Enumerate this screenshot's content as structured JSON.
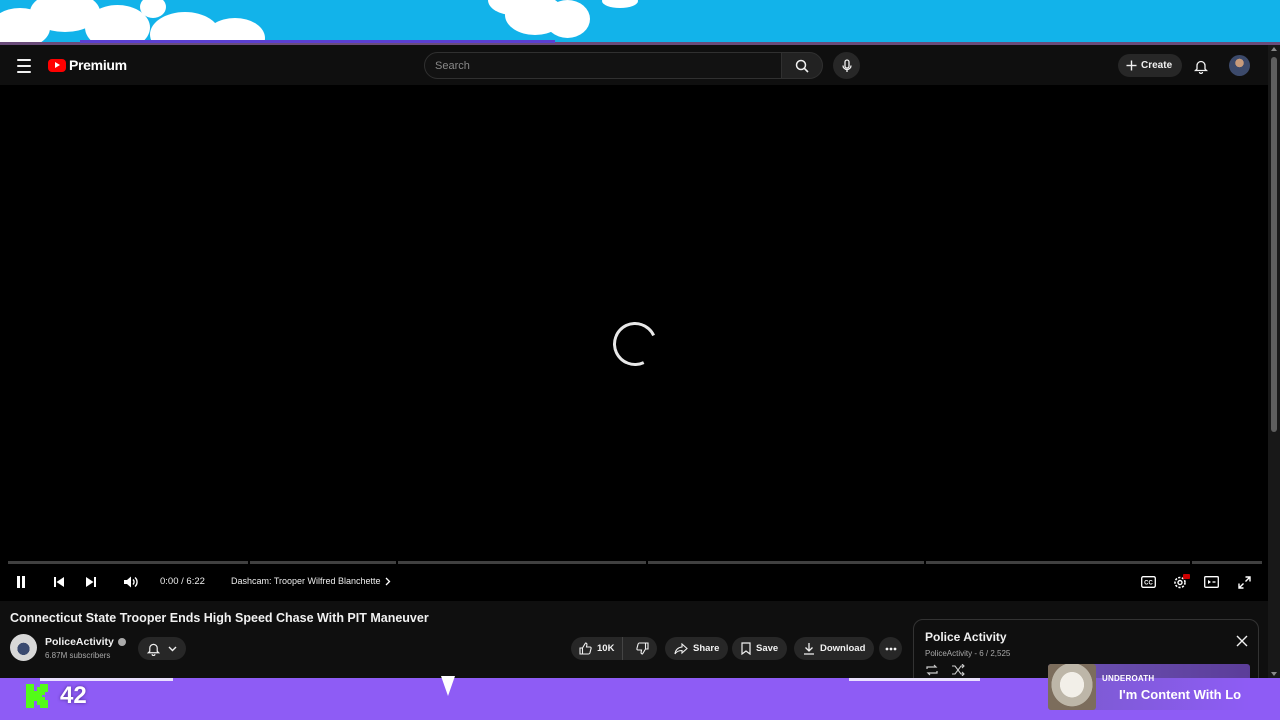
{
  "header": {
    "logo_text": "Premium",
    "search_placeholder": "Search",
    "create_label": "Create"
  },
  "player": {
    "state": "loading",
    "time": "0:00 / 6:22",
    "chapter_title": "Dashcam: Trooper Wilfred Blanchette"
  },
  "video": {
    "title": "Connecticut State Trooper Ends High Speed Chase With PIT Maneuver",
    "channel_name": "PoliceActivity",
    "subscribers": "6.87M subscribers",
    "likes": "10K",
    "share_label": "Share",
    "save_label": "Save",
    "download_label": "Download"
  },
  "playlist": {
    "title": "Police Activity",
    "subtitle": "PoliceActivity - 6 / 2,525"
  },
  "overlay": {
    "viewer_count": "42",
    "now_playing_artist": "UNDEROATH",
    "now_playing_song": "I'm Content With Lo"
  },
  "colors": {
    "accent_red": "#ff0000",
    "sky_blue": "#12b3ea",
    "overlay_purple": "#8e5cf5",
    "kick_green": "#53fc18"
  }
}
